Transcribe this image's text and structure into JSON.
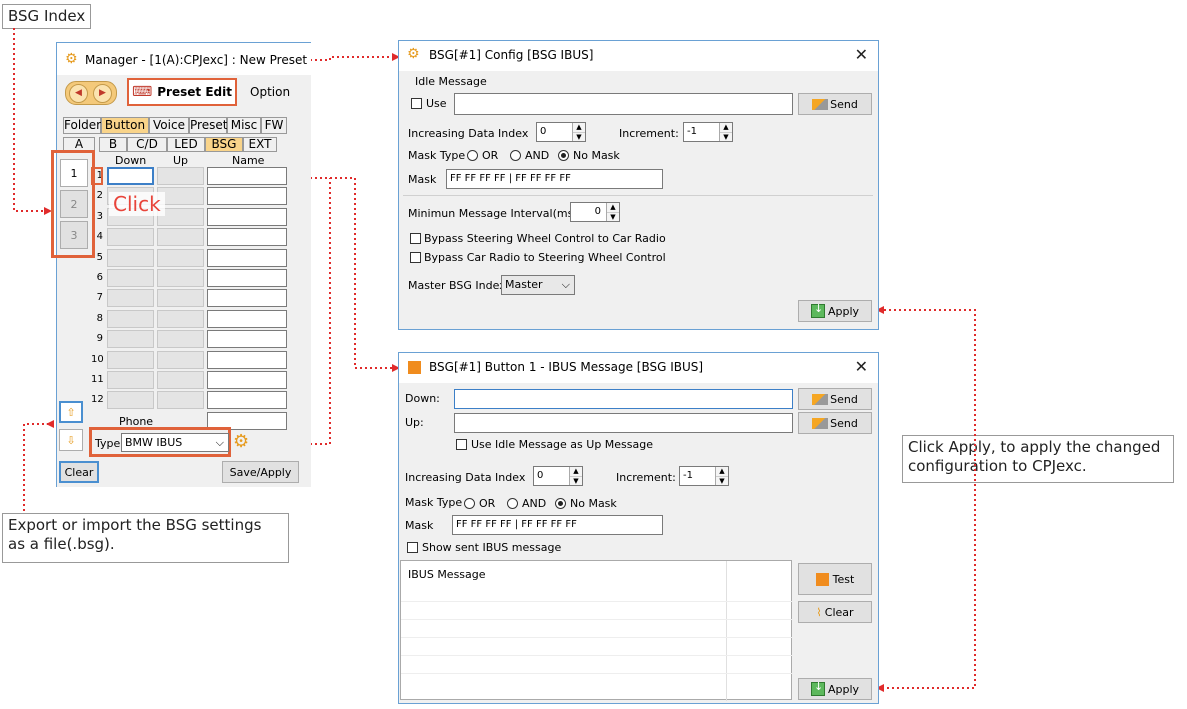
{
  "annotations": {
    "bsg_index": "BSG Index",
    "export_import": "Export or import the BSG settings\nas a file(.bsg).",
    "click_apply": "Click Apply, to apply the changed\nconfiguration to CPJexc.",
    "click": "Click"
  },
  "manager": {
    "title": "Manager - [1(A):CPJexc] : New Preset",
    "preset_edit": "Preset Edit",
    "option": "Option",
    "main_tabs": [
      "Folder",
      "Button",
      "Voice",
      "Preset",
      "Misc",
      "FW"
    ],
    "sub_tabs": [
      "A",
      "B",
      "C/D",
      "LED",
      "BSG",
      "EXT"
    ],
    "bsg_index_buttons": [
      "1",
      "2",
      "3"
    ],
    "col_headers": [
      "Down",
      "Up",
      "Name"
    ],
    "rows": [
      "1",
      "2",
      "3",
      "4",
      "5",
      "6",
      "7",
      "8",
      "9",
      "10",
      "11",
      "12"
    ],
    "phone_label": "Phone",
    "type_label": "Type",
    "type_value": "BMW IBUS",
    "clear": "Clear",
    "save_apply": "Save/Apply"
  },
  "config_window": {
    "title": "BSG[#1] Config [BSG IBUS]",
    "idle_message": "Idle Message",
    "use": "Use",
    "send": "Send",
    "inc_index_label": "Increasing Data Index",
    "inc_index_value": "0",
    "increment_label": "Increment:",
    "increment_value": "-1",
    "mask_type_label": "Mask Type",
    "mask_or": "OR",
    "mask_and": "AND",
    "mask_none": "No Mask",
    "mask_label": "Mask",
    "mask_value": "FF FF FF FF | FF FF FF FF",
    "min_interval_label": "Minimun Message Interval(ms)",
    "min_interval_value": "0",
    "bypass1": "Bypass Steering Wheel Control to Car Radio",
    "bypass2": "Bypass Car Radio to Steering Wheel Control",
    "master_label": "Master BSG Index",
    "master_value": "Master",
    "apply": "Apply"
  },
  "button_window": {
    "title": "BSG[#1] Button 1 - IBUS Message [BSG IBUS]",
    "down_label": "Down:",
    "up_label": "Up:",
    "send": "Send",
    "use_idle": "Use Idle Message as Up Message",
    "inc_index_label": "Increasing Data Index",
    "inc_index_value": "0",
    "increment_label": "Increment:",
    "increment_value": "-1",
    "mask_type_label": "Mask Type",
    "mask_or": "OR",
    "mask_and": "AND",
    "mask_none": "No Mask",
    "mask_label": "Mask",
    "mask_value": "FF FF FF FF | FF FF FF FF",
    "show_sent": "Show sent IBUS message",
    "ibus_header": "IBUS Message",
    "test": "Test",
    "clear": "Clear",
    "apply": "Apply"
  },
  "colors": {
    "accent": "#e02b2b",
    "tab_selected": "#f9d48a",
    "window_border": "#6aa1d4"
  }
}
